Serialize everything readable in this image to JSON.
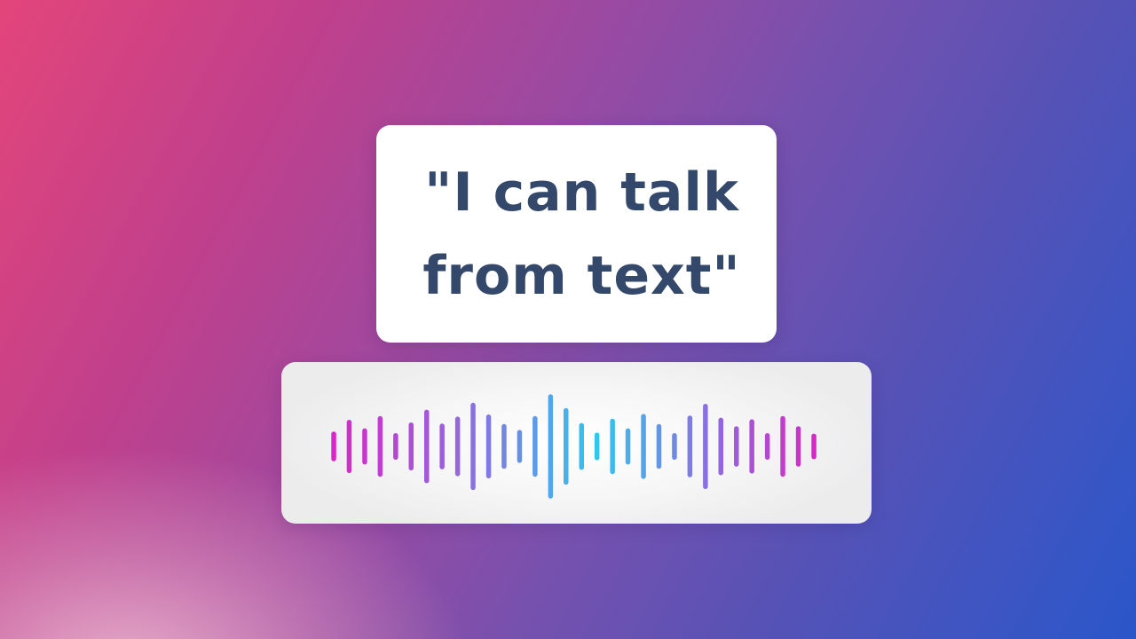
{
  "quote": {
    "line1": "\"I can talk",
    "line2": "from text\""
  },
  "waveform": {
    "icon": "sound-wave-icon",
    "levels": [
      0.28,
      0.5,
      0.34,
      0.57,
      0.25,
      0.45,
      0.69,
      0.43,
      0.56,
      0.82,
      0.6,
      0.42,
      0.31,
      0.57,
      0.98,
      0.72,
      0.44,
      0.26,
      0.52,
      0.34,
      0.61,
      0.42,
      0.25,
      0.58,
      0.8,
      0.54,
      0.38,
      0.51,
      0.25,
      0.57,
      0.38,
      0.24
    ],
    "colors": {
      "edge": "#d926c4",
      "mid": "#8e6ce0",
      "center": "#30c7ef"
    }
  }
}
